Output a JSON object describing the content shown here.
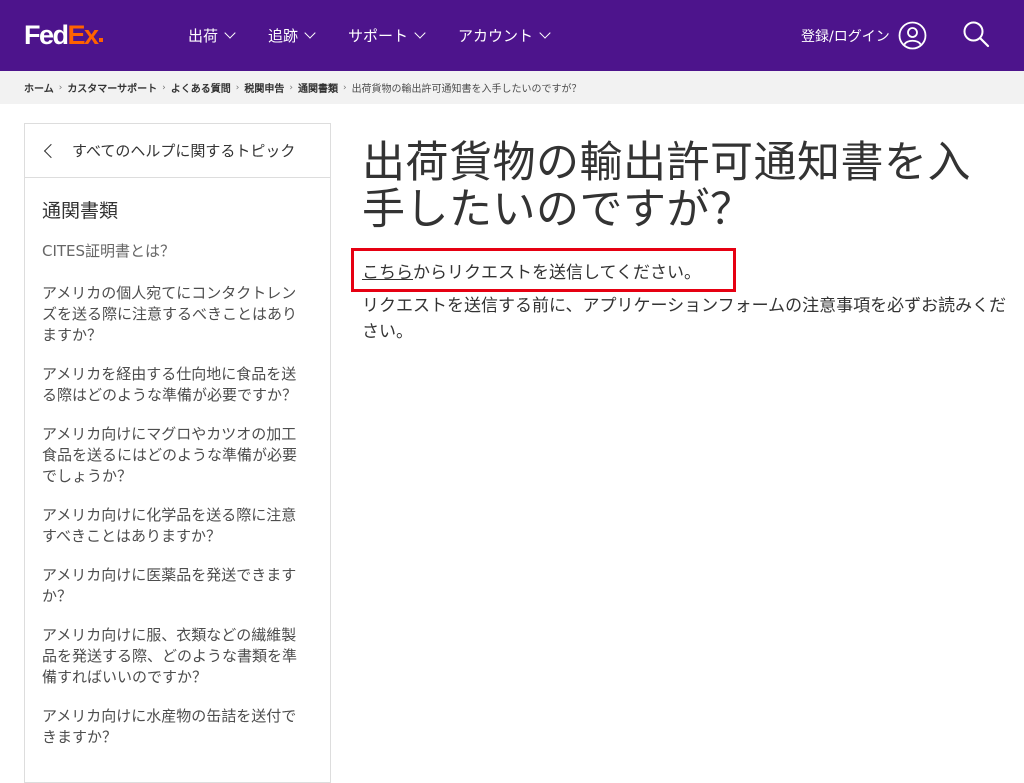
{
  "brand": {
    "logo_fed": "Fed",
    "logo_ex": "Ex",
    "accent_color": "#4d148c",
    "logo_orange": "#ff6200"
  },
  "header": {
    "nav": [
      {
        "label": "出荷"
      },
      {
        "label": "追跡"
      },
      {
        "label": "サポート"
      },
      {
        "label": "アカウント"
      }
    ],
    "login_label": "登録/ログイン",
    "icons": {
      "user": "user-circle-icon",
      "search": "search-icon"
    }
  },
  "breadcrumb": {
    "items": [
      "ホーム",
      "カスタマーサポート",
      "よくある質問",
      "税関申告",
      "通関書類"
    ],
    "current": "出荷貨物の輸出許可通知書を入手したいのですが？"
  },
  "sidebar": {
    "back_label": "すべてのヘルプに関するトピック",
    "section_title": "通関書類",
    "items": [
      "CITES証明書とは？",
      "アメリカの個人宛てにコンタクトレンズを送る際に注意するべきことはありますか？",
      "アメリカを経由する仕向地に食品を送る際はどのような準備が必要ですか？",
      "アメリカ向けにマグロやカツオの加工食品を送るにはどのような準備が必要でしょうか？",
      "アメリカ向けに化学品を送る際に注意すべきことはありますか？",
      "アメリカ向けに医薬品を発送できますか？",
      "アメリカ向けに服、衣類などの繊維製品を発送する際、どのような書類を準備すればいいのですか？",
      "アメリカ向けに水産物の缶詰を送付できますか？"
    ]
  },
  "main": {
    "title": "出荷貨物の輸出許可通知書を入手したいのですが？",
    "request_link": "こちら",
    "request_text": "からリクエストを送信してください。",
    "note": "リクエストを送信する前に、アプリケーションフォームの注意事項を必ずお読みください。",
    "highlight_color": "#e60012"
  }
}
